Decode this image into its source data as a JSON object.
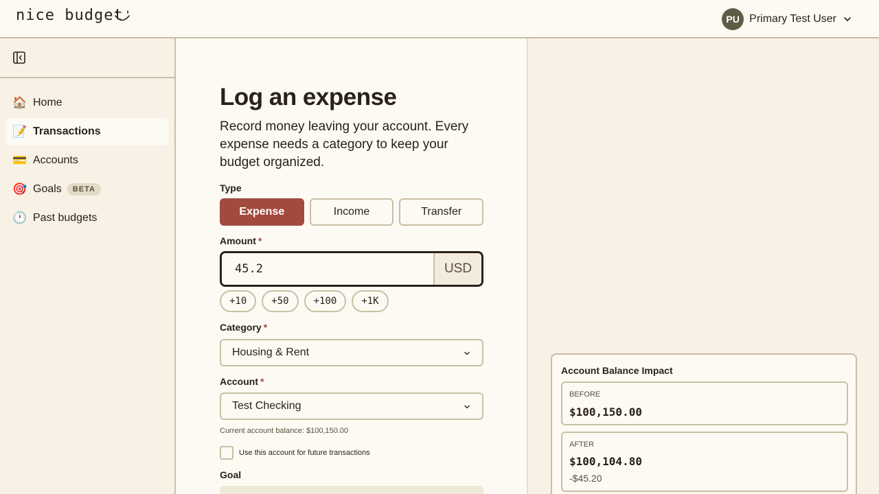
{
  "app": {
    "logo_text": "nice budget"
  },
  "user": {
    "initials": "PU",
    "name": "Primary Test User"
  },
  "sidebar": {
    "items": [
      {
        "label": "Home",
        "icon": "🏠"
      },
      {
        "label": "Transactions",
        "icon": "📝"
      },
      {
        "label": "Accounts",
        "icon": "💳"
      },
      {
        "label": "Goals",
        "icon": "🎯",
        "badge": "BETA"
      },
      {
        "label": "Past budgets",
        "icon": "🕐"
      }
    ]
  },
  "form": {
    "title": "Log an expense",
    "subtitle": "Record money leaving your account. Every expense needs a category to keep your budget organized.",
    "type_label": "Type",
    "types": [
      "Expense",
      "Income",
      "Transfer"
    ],
    "amount_label": "Amount",
    "required_mark": "*",
    "amount_value": "45.2",
    "currency": "USD",
    "quick_amounts": [
      "+10",
      "+50",
      "+100",
      "+1K"
    ],
    "category_label": "Category",
    "category_value": "Housing & Rent",
    "account_label": "Account",
    "account_value": "Test Checking",
    "balance_note": "Current account balance: $100,150.00",
    "remember_label": "Use this account for future transactions",
    "goal_label": "Goal"
  },
  "impact": {
    "title": "Account Balance Impact",
    "before_label": "BEFORE",
    "before_value": "$100,150.00",
    "after_label": "AFTER",
    "after_value": "$100,104.80",
    "delta": "-$45.20"
  },
  "colors": {
    "accent": "#a34a3f",
    "border": "#c9bfa5",
    "panel": "#fdfaf3",
    "background": "#f7f1e6"
  }
}
